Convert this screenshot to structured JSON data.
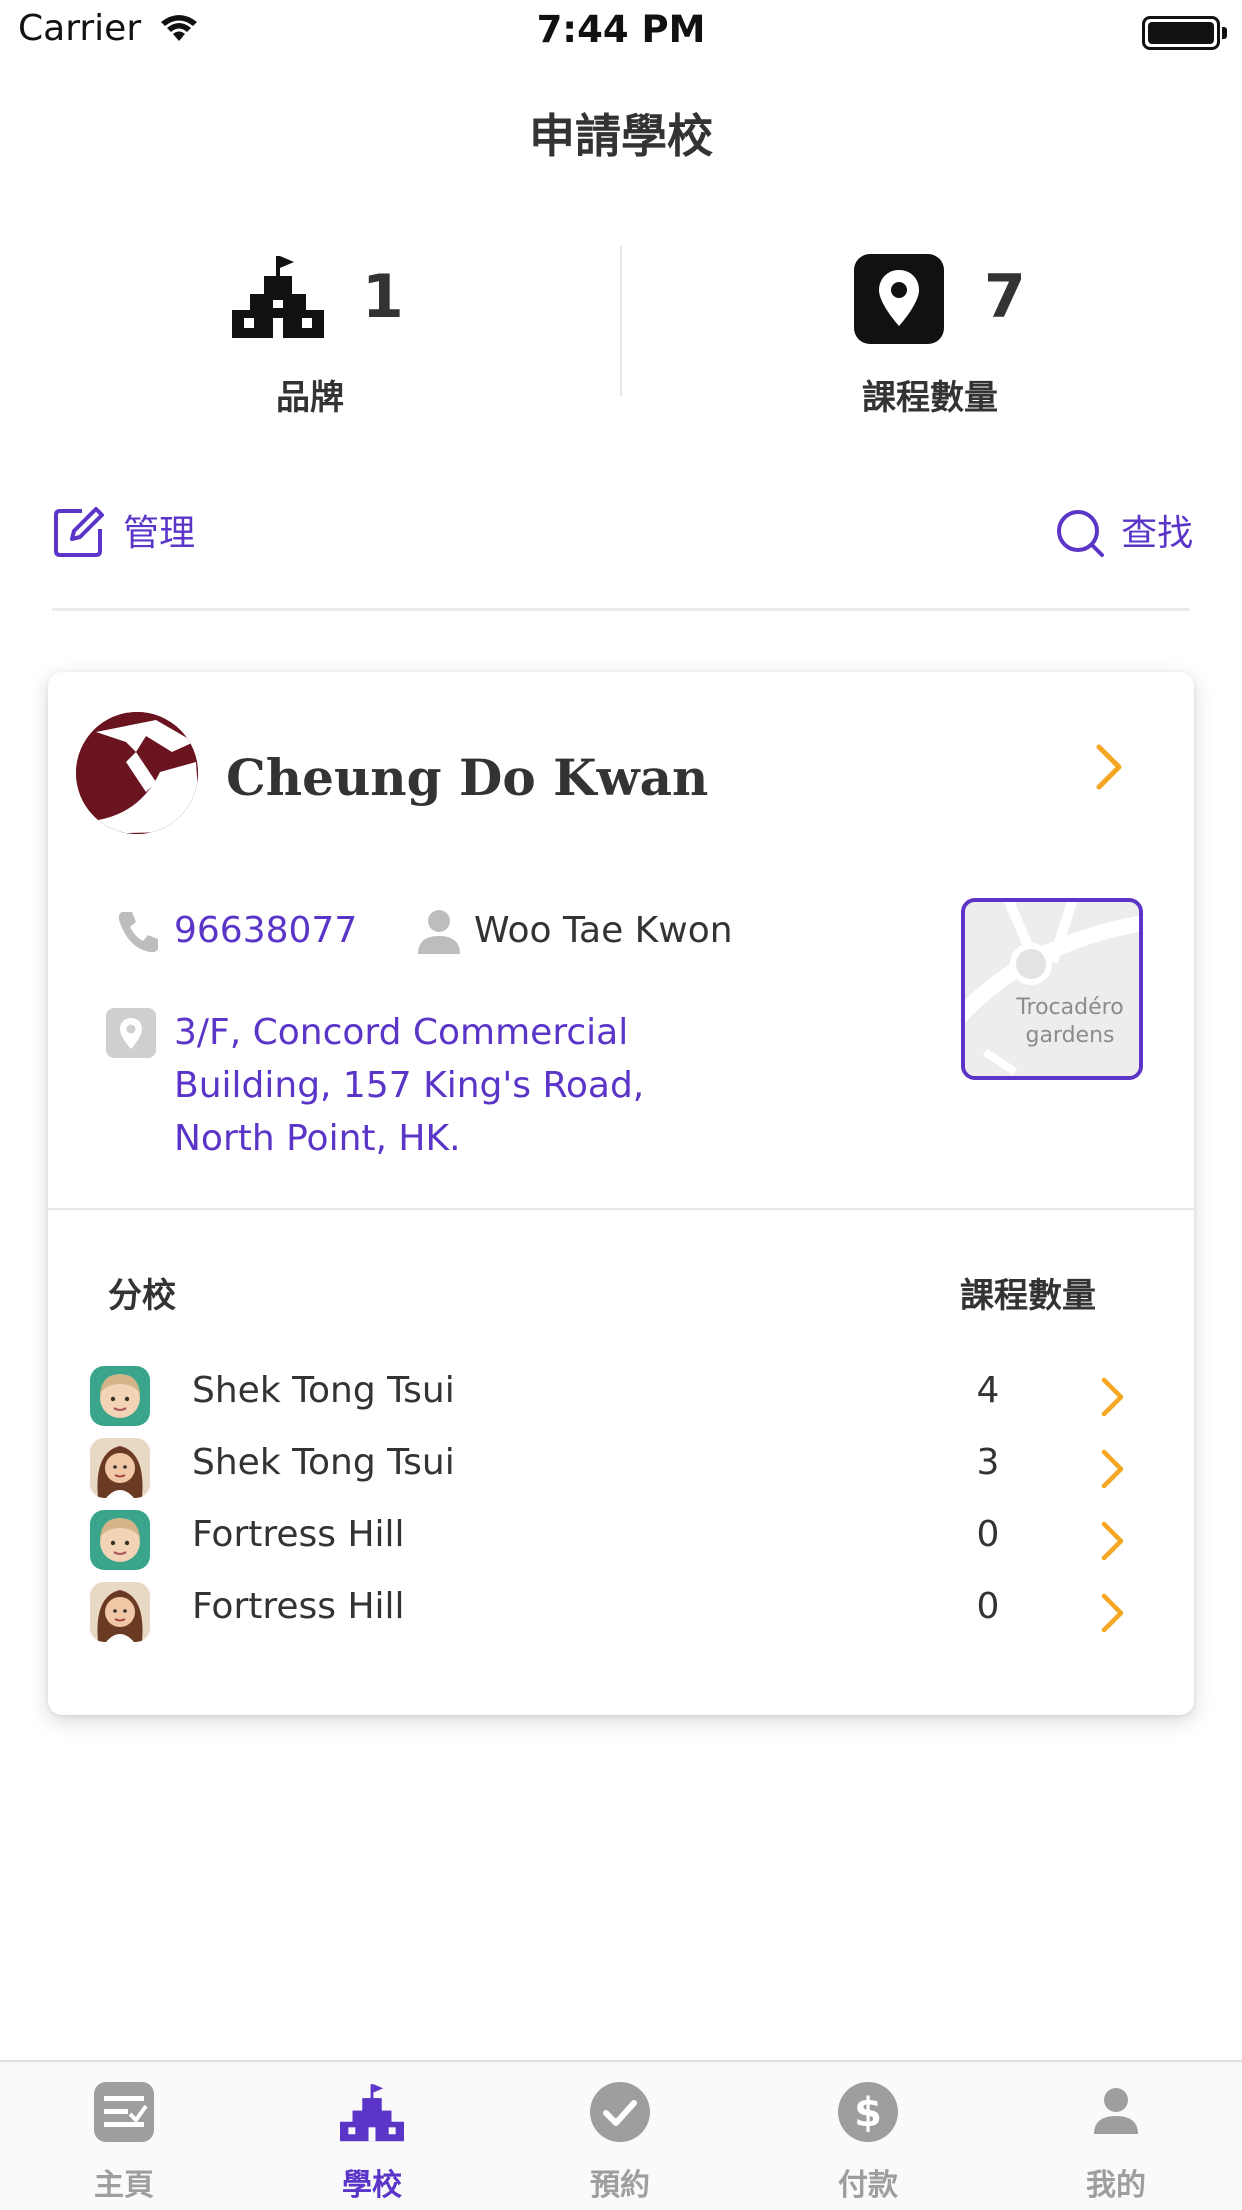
{
  "status_bar": {
    "carrier": "Carrier",
    "time": "7:44 PM"
  },
  "nav": {
    "title": "申請學校"
  },
  "stats": {
    "brand": {
      "value": "1",
      "label": "品牌",
      "icon": "school-icon"
    },
    "courses": {
      "value": "7",
      "label": "課程數量",
      "icon": "location-pin-icon"
    }
  },
  "actions": {
    "manage": "管理",
    "search": "查找"
  },
  "school": {
    "name": "Cheung Do Kwan",
    "phone": "96638077",
    "contact": "Woo Tae Kwon",
    "address_lines": [
      "3/F, Concord Commercial",
      "Building, 157 King's Road,",
      "North Point, HK."
    ],
    "map_label_lines": [
      "Trocadéro",
      "gardens"
    ]
  },
  "branches": {
    "header_name": "分校",
    "header_count": "課程數量",
    "rows": [
      {
        "name": "Shek Tong Tsui",
        "count": "4",
        "avatar": "male-avatar"
      },
      {
        "name": "Shek Tong Tsui",
        "count": "3",
        "avatar": "female-avatar"
      },
      {
        "name": "Fortress Hill",
        "count": "0",
        "avatar": "male-avatar"
      },
      {
        "name": "Fortress Hill",
        "count": "0",
        "avatar": "female-avatar"
      }
    ]
  },
  "tabs": [
    {
      "label": "主頁",
      "icon": "home-icon",
      "active": false
    },
    {
      "label": "學校",
      "icon": "school-icon",
      "active": true
    },
    {
      "label": "預約",
      "icon": "check-circle-icon",
      "active": false
    },
    {
      "label": "付款",
      "icon": "dollar-icon",
      "active": false
    },
    {
      "label": "我的",
      "icon": "person-icon",
      "active": false
    }
  ],
  "colors": {
    "accent": "#5a35c8",
    "chevron": "#f5a623",
    "inactive_tab": "#9e9e9e"
  }
}
